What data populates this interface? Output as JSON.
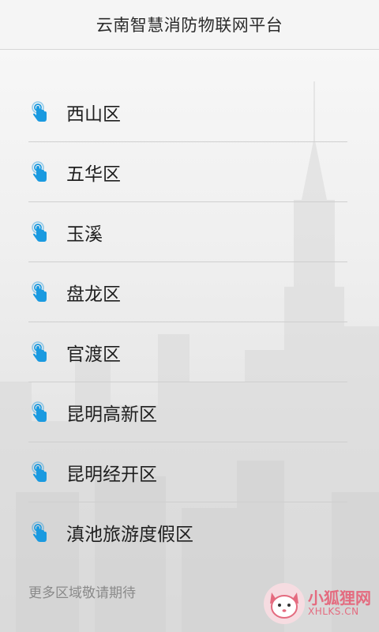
{
  "header": {
    "title": "云南智慧消防物联网平台"
  },
  "regions": [
    {
      "label": "西山区"
    },
    {
      "label": "五华区"
    },
    {
      "label": "玉溪"
    },
    {
      "label": "盘龙区"
    },
    {
      "label": "官渡区"
    },
    {
      "label": "昆明高新区"
    },
    {
      "label": "昆明经开区"
    },
    {
      "label": "滇池旅游度假区"
    }
  ],
  "footer": {
    "note": "更多区域敬请期待"
  },
  "icons": {
    "list_item_icon": "touch-pointer-icon",
    "watermark_logo": "fox-logo-icon"
  },
  "colors": {
    "icon_blue": "#1a9ae0",
    "watermark_pink": "#e46b7f"
  },
  "watermark": {
    "name_cn": "小狐狸网",
    "domain": "XHLKS.CN"
  }
}
